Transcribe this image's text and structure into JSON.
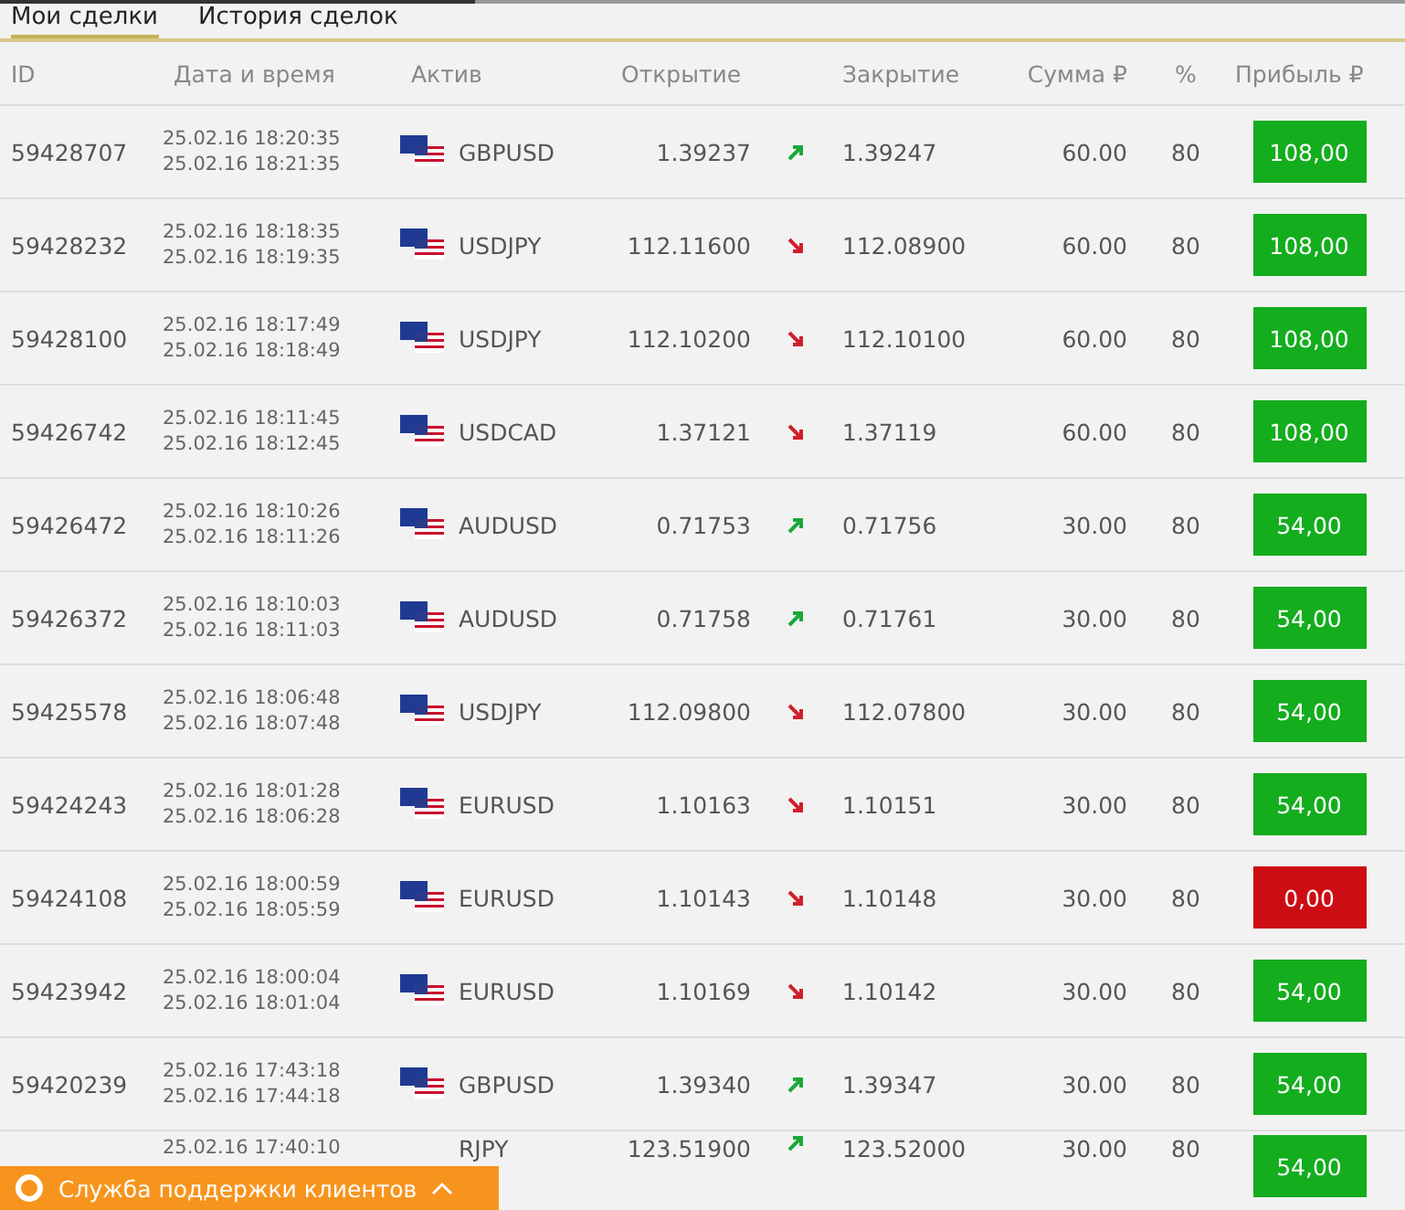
{
  "tabs": [
    {
      "label": "Мои сделки",
      "selected": true
    },
    {
      "label": "История сделок",
      "selected": false
    }
  ],
  "columns": [
    "ID",
    "Дата и время",
    "Актив",
    "Открытие",
    "Закрытие",
    "Сумма ₽",
    "%",
    "Прибыль ₽"
  ],
  "rows": [
    {
      "id": "59428707",
      "opened": "25.02.16 18:20:35",
      "closed": "25.02.16 18:21:35",
      "asset": "GBPUSD",
      "open": "1.39237",
      "rising": true,
      "close": "1.39247",
      "amount": "60.00",
      "percent": "80",
      "profit": "108,00",
      "profitable": true
    },
    {
      "id": "59428232",
      "opened": "25.02.16 18:18:35",
      "closed": "25.02.16 18:19:35",
      "asset": "USDJPY",
      "open": "112.11600",
      "rising": false,
      "close": "112.08900",
      "amount": "60.00",
      "percent": "80",
      "profit": "108,00",
      "profitable": true
    },
    {
      "id": "59428100",
      "opened": "25.02.16 18:17:49",
      "closed": "25.02.16 18:18:49",
      "asset": "USDJPY",
      "open": "112.10200",
      "rising": false,
      "close": "112.10100",
      "amount": "60.00",
      "percent": "80",
      "profit": "108,00",
      "profitable": true
    },
    {
      "id": "59426742",
      "opened": "25.02.16 18:11:45",
      "closed": "25.02.16 18:12:45",
      "asset": "USDCAD",
      "open": "1.37121",
      "rising": false,
      "close": "1.37119",
      "amount": "60.00",
      "percent": "80",
      "profit": "108,00",
      "profitable": true
    },
    {
      "id": "59426472",
      "opened": "25.02.16 18:10:26",
      "closed": "25.02.16 18:11:26",
      "asset": "AUDUSD",
      "open": "0.71753",
      "rising": true,
      "close": "0.71756",
      "amount": "30.00",
      "percent": "80",
      "profit": "54,00",
      "profitable": true
    },
    {
      "id": "59426372",
      "opened": "25.02.16 18:10:03",
      "closed": "25.02.16 18:11:03",
      "asset": "AUDUSD",
      "open": "0.71758",
      "rising": true,
      "close": "0.71761",
      "amount": "30.00",
      "percent": "80",
      "profit": "54,00",
      "profitable": true
    },
    {
      "id": "59425578",
      "opened": "25.02.16 18:06:48",
      "closed": "25.02.16 18:07:48",
      "asset": "USDJPY",
      "open": "112.09800",
      "rising": false,
      "close": "112.07800",
      "amount": "30.00",
      "percent": "80",
      "profit": "54,00",
      "profitable": true
    },
    {
      "id": "59424243",
      "opened": "25.02.16 18:01:28",
      "closed": "25.02.16 18:06:28",
      "asset": "EURUSD",
      "open": "1.10163",
      "rising": false,
      "close": "1.10151",
      "amount": "30.00",
      "percent": "80",
      "profit": "54,00",
      "profitable": true
    },
    {
      "id": "59424108",
      "opened": "25.02.16 18:00:59",
      "closed": "25.02.16 18:05:59",
      "asset": "EURUSD",
      "open": "1.10143",
      "rising": false,
      "close": "1.10148",
      "amount": "30.00",
      "percent": "80",
      "profit": "0,00",
      "profitable": false
    },
    {
      "id": "59423942",
      "opened": "25.02.16 18:00:04",
      "closed": "25.02.16 18:01:04",
      "asset": "EURUSD",
      "open": "1.10169",
      "rising": false,
      "close": "1.10142",
      "amount": "30.00",
      "percent": "80",
      "profit": "54,00",
      "profitable": true
    },
    {
      "id": "59420239",
      "opened": "25.02.16 17:43:18",
      "closed": "25.02.16 17:44:18",
      "asset": "GBPUSD",
      "open": "1.39340",
      "rising": true,
      "close": "1.39347",
      "amount": "30.00",
      "percent": "80",
      "profit": "54,00",
      "profitable": true
    },
    {
      "opened": "25.02.16 17:40:10",
      "asset": "RJPY",
      "open": "123.51900",
      "rising": true,
      "close": "123.52000",
      "amount": "30.00",
      "percent": "80",
      "profit": "54,00",
      "profitable": true
    }
  ],
  "support_bar": {
    "label": "Служба поддержки клиентов"
  }
}
